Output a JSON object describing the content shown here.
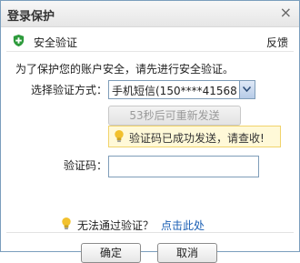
{
  "dialog": {
    "title": "登录保护",
    "close_glyph": "×"
  },
  "security": {
    "title": "安全验证",
    "feedback": "反馈",
    "notice": "为了保护您的账户安全，请先进行安全验证。"
  },
  "form": {
    "method_label": "选择验证方式：",
    "method_value": "手机短信(150****41568",
    "resend_label": "53秒后可重新发送",
    "tip_text": "验证码已成功发送，请查收!",
    "code_label": "验证码：",
    "code_value": ""
  },
  "footer": {
    "cant_verify": "无法通过验证？",
    "link": "点击此处",
    "ok_label": "确定",
    "cancel_label": "取消"
  },
  "icons": {
    "shield": "shield-check-icon",
    "bulb": "lightbulb-icon",
    "close": "close-icon",
    "dropdown": "chevron-down-icon"
  },
  "colors": {
    "shield": "#2e9b3c",
    "link": "#1a5fb4",
    "tip_bg": "#fff9d8",
    "bulb": "#f2c12e"
  }
}
